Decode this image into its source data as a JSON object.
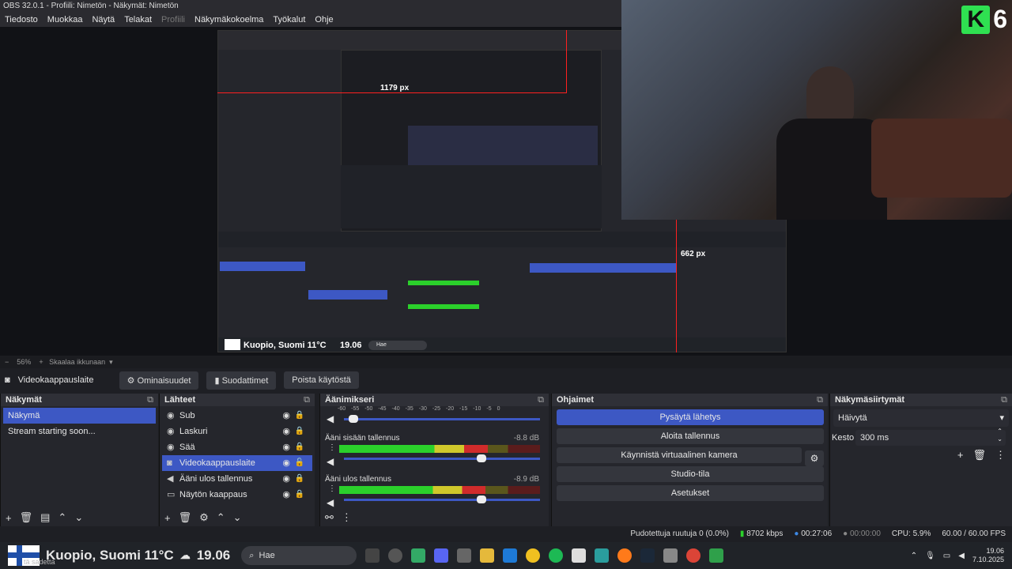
{
  "window": {
    "title": "OBS 32.0.1 - Profiili: Nimetön - Näkymät: Nimetön"
  },
  "menu": {
    "items": [
      "Tiedosto",
      "Muokkaa",
      "Näytä",
      "Telakat",
      "Profiili",
      "Näkymäkokoelma",
      "Työkalut",
      "Ohje"
    ],
    "disabled": "Profiili"
  },
  "preview": {
    "label_1179": "1179 px",
    "label_662": "662 px",
    "nested_labels": {
      "kuopio": "Kuopio, Suomi 11°C",
      "time": "19.06",
      "search": "Hae"
    },
    "webcam_logo_letter": "K",
    "webcam_logo_number": "6"
  },
  "scalebar": {
    "minus": "−",
    "zoom": "56%",
    "plus": "+",
    "mode": "Skaalaa ikkunaan"
  },
  "scenebar": {
    "source_name": "Videokaappauslaite",
    "properties": "Ominaisuudet",
    "filters": "Suodattimet",
    "disable": "Poista käytöstä"
  },
  "scenes": {
    "title": "Näkymät",
    "items": [
      "Näkymä",
      "Stream starting soon..."
    ],
    "selected": 0
  },
  "sources": {
    "title": "Lähteet",
    "items": [
      {
        "icon": "globe-icon",
        "label": "Sub"
      },
      {
        "icon": "globe-icon",
        "label": "Laskuri"
      },
      {
        "icon": "globe-icon",
        "label": "Sää"
      },
      {
        "icon": "camera-icon",
        "label": "Videokaappauslaite"
      },
      {
        "icon": "speaker-icon",
        "label": "Ääni ulos tallennus"
      },
      {
        "icon": "monitor-icon",
        "label": "Näytön kaappaus"
      }
    ],
    "selected": 3
  },
  "mixer": {
    "title": "Äänimikseri",
    "scale": [
      "-60",
      "-55",
      "-50",
      "-45",
      "-40",
      "-35",
      "-30",
      "-25",
      "-20",
      "-15",
      "-10",
      "-5",
      "0"
    ],
    "channels": [
      {
        "name": "",
        "db": "",
        "level": 0,
        "fader": 0.05
      },
      {
        "name": "Ääni sisään tallennus",
        "db": "-8.8 dB",
        "level": 0.74,
        "fader": 0.7
      },
      {
        "name": "Ääni ulos tallennus",
        "db": "-8.9 dB",
        "level": 0.73,
        "fader": 0.7
      }
    ]
  },
  "controls": {
    "title": "Ohjaimet",
    "stop_stream": "Pysäytä lähetys",
    "start_recording": "Aloita tallennus",
    "virtual_cam": "Käynnistä virtuaalinen kamera",
    "studio": "Studio-tila",
    "settings": "Asetukset"
  },
  "transitions": {
    "title": "Näkymäsiirtymät",
    "type": "Häivytä",
    "duration_label": "Kesto",
    "duration": "300 ms"
  },
  "status": {
    "dropped": "Pudotettuja ruutuja 0 (0.0%)",
    "kbps": "8702 kbps",
    "stream_time": "00:27:06",
    "rec_time": "00:00:00",
    "cpu": "CPU: 5.9%",
    "fps": "60.00 / 60.00 FPS"
  },
  "taskbar": {
    "weather": "Kuopio, Suomi 11°C",
    "time_big": "19.06",
    "search": "Hae",
    "clock_time": "19.06",
    "clock_date": "7.10.2025",
    "caption": "tä sadetta"
  },
  "colors": {
    "accent": "#3d58c4",
    "meter_green": "#2bd02b",
    "meter_yellow": "#d0c82b",
    "meter_red": "#d02b2b",
    "logo_green": "#2fe051"
  }
}
